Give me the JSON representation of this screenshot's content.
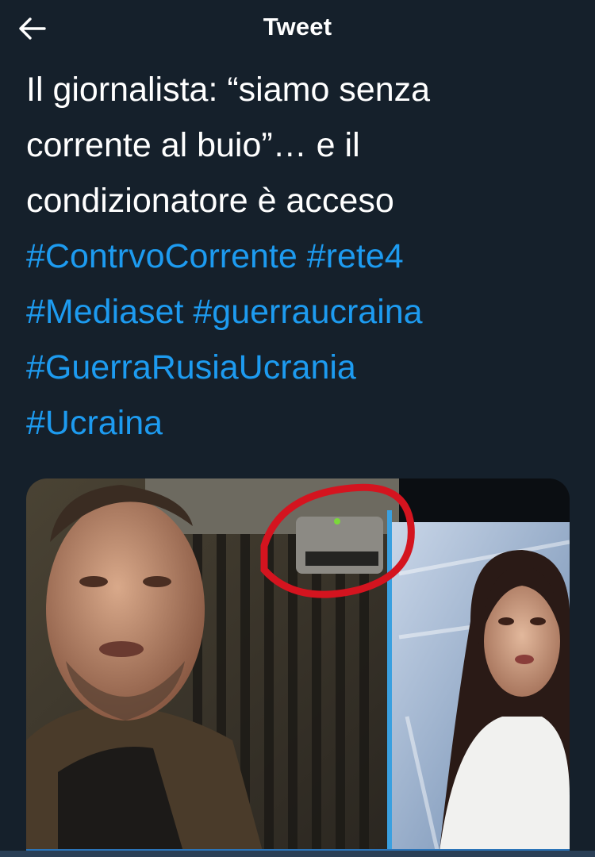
{
  "header": {
    "title": "Tweet",
    "back_icon": "arrow-left-icon"
  },
  "tweet": {
    "text_line1": "Il giornalista: “siamo senza",
    "text_line2": "corrente al buio”… e il",
    "text_line3": "condizionatore è acceso",
    "hashtags": [
      "#ContrvoCorrente",
      "#rete4",
      "#Mediaset",
      "#guerraucraina",
      "#GuerraRusiaUcrania",
      "#Ucraina"
    ]
  },
  "media": {
    "type": "photo",
    "annotation_color": "#d4141f"
  },
  "colors": {
    "background": "#15202b",
    "text": "#ffffff",
    "link": "#1d9bf0"
  }
}
